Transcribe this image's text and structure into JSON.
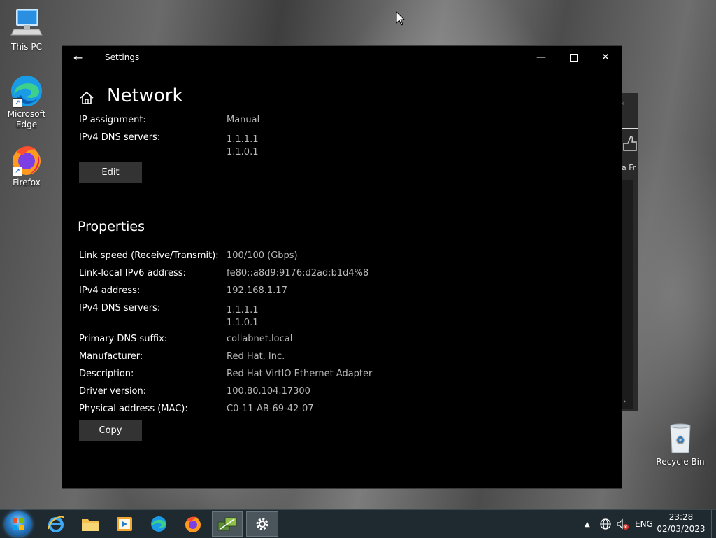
{
  "desktop": {
    "icons": [
      {
        "label": "This PC"
      },
      {
        "label": "Microsoft Edge"
      },
      {
        "label": "Firefox"
      },
      {
        "label": "Recycle Bin"
      }
    ],
    "background_window_fragment": "a Fr"
  },
  "window": {
    "title": "Settings",
    "back_glyph": "←",
    "minimize_glyph": "—",
    "close_glyph": "✕",
    "page_title": "Network",
    "ip_settings": {
      "ip_assignment_label": "IP assignment:",
      "ip_assignment_value": "Manual",
      "dns_label": "IPv4 DNS servers:",
      "dns_values": [
        "1.1.1.1",
        "1.1.0.1"
      ],
      "edit_label": "Edit"
    },
    "properties": {
      "title": "Properties",
      "link_speed_label": "Link speed (Receive/Transmit):",
      "link_speed_value": "100/100 (Gbps)",
      "ipv6_label": "Link-local IPv6 address:",
      "ipv6_value": "fe80::a8d9:9176:d2ad:b1d4%8",
      "ipv4_label": "IPv4 address:",
      "ipv4_value": "192.168.1.17",
      "dns_label": "IPv4 DNS servers:",
      "dns_values": [
        "1.1.1.1",
        "1.1.0.1"
      ],
      "dns_suffix_label": "Primary DNS suffix:",
      "dns_suffix_value": "collabnet.local",
      "manufacturer_label": "Manufacturer:",
      "manufacturer_value": "Red Hat, Inc.",
      "description_label": "Description:",
      "description_value": "Red Hat VirtIO Ethernet Adapter",
      "driver_label": "Driver version:",
      "driver_value": "100.80.104.17300",
      "mac_label": "Physical address (MAC):",
      "mac_value": "C0-11-AB-69-42-07",
      "copy_label": "Copy"
    }
  },
  "taskbar": {
    "apps": [
      "internet-explorer",
      "file-explorer",
      "media-player",
      "edge",
      "firefox",
      "network-app",
      "settings"
    ],
    "tray": {
      "language": "ENG",
      "time": "23:28",
      "date": "02/03/2023"
    }
  },
  "colors": {
    "window_bg": "#000000",
    "value_text": "#b9b9b9",
    "button_bg": "#333333",
    "taskbar_bg": "#1f2a30"
  }
}
